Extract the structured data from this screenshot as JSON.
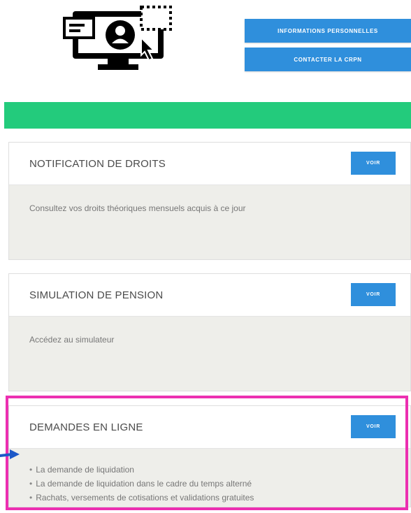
{
  "header": {
    "logo_icon": "monitor-user-cursor-icon",
    "buttons": [
      {
        "label": "INFORMATIONS PERSONNELLES"
      },
      {
        "label": "CONTACTER LA CRPN"
      }
    ]
  },
  "colors": {
    "accent_blue": "#2f8fdc",
    "green_bar": "#23cb7c",
    "highlight_pink": "#ec2fb1"
  },
  "cards": [
    {
      "title": "NOTIFICATION DE DROITS",
      "button_label": "VOIR",
      "description": "Consultez vos droits théoriques mensuels acquis à ce jour"
    },
    {
      "title": "SIMULATION DE PENSION",
      "button_label": "VOIR",
      "description": "Accédez au simulateur"
    },
    {
      "title": "DEMANDES EN LIGNE",
      "button_label": "VOIR",
      "items": [
        "La demande de liquidation",
        "La demande de liquidation dans le cadre du temps alterné",
        "Rachats, versements de cotisations et validations gratuites"
      ]
    }
  ],
  "annotation": {
    "arrow_icon": "arrow-right-icon",
    "highlight": "pink-rectangle"
  }
}
